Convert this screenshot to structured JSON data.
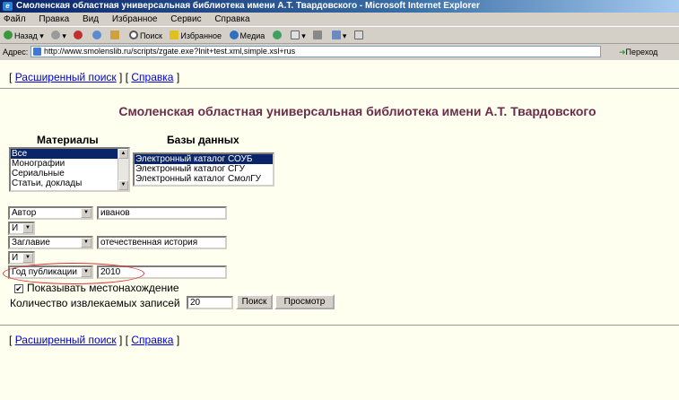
{
  "window": {
    "title": "Смоленская областная универсальная библиотека имени А.Т. Твардовского - Microsoft Internet Explorer"
  },
  "menu": [
    "Файл",
    "Правка",
    "Вид",
    "Избранное",
    "Сервис",
    "Справка"
  ],
  "toolbar": {
    "back": "Назад",
    "search": "Поиск",
    "favorites": "Избранное",
    "media": "Медиа"
  },
  "address": {
    "label": "Адрес:",
    "url": "http://www.smolenslib.ru/scripts/zgate.exe?Init+test.xml,simple.xsl+rus",
    "go": "Переход"
  },
  "page": {
    "top_links": {
      "open": "[",
      "advanced": "Расширенный поиск",
      "mid": "] [",
      "help": "Справка",
      "close": "]"
    },
    "heading": "Смоленская областная универсальная библиотека имени А.Т. Твардовского",
    "materials_label": "Материалы",
    "databases_label": "Базы данных",
    "materials": [
      "Все",
      "Монографии",
      "Сериальные",
      "Статьи, доклады"
    ],
    "databases": [
      "Электронный каталог СОУБ",
      "Электронный каталог СГУ",
      "Электронный каталог СмолГУ"
    ],
    "rows": {
      "field1": "Автор",
      "value1": "иванов",
      "op1": "И",
      "field2": "Заглавие",
      "value2": "отечественная история",
      "op2": "И",
      "field3": "Год публикации",
      "value3": "2010"
    },
    "show_location": "Показывать местонахождение",
    "records_label": "Количество извлекаемых записей",
    "records_value": "20",
    "search_button": "Поиск",
    "view_button": "Просмотр",
    "check_mark": "✔"
  }
}
